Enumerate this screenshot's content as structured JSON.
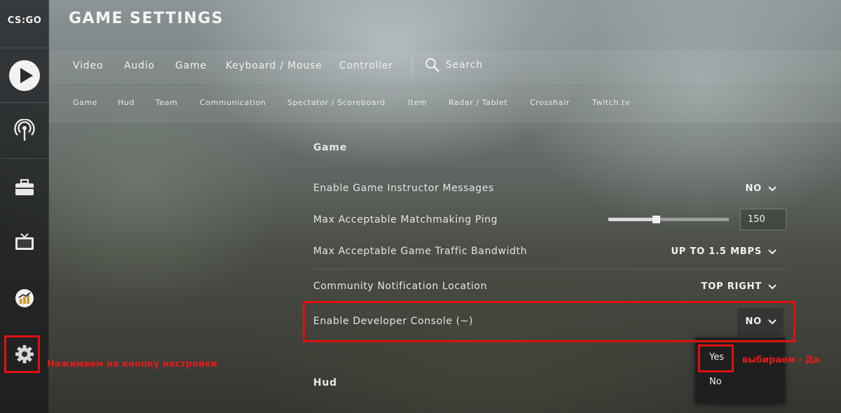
{
  "app": {
    "logo": "CS:GO"
  },
  "header": {
    "title": "GAME SETTINGS"
  },
  "sidebar": {
    "items": [
      {
        "name": "play",
        "icon": "play-icon"
      },
      {
        "name": "broadcast",
        "icon": "antenna-icon"
      },
      {
        "name": "inventory",
        "icon": "briefcase-icon"
      },
      {
        "name": "watch",
        "icon": "tv-icon"
      },
      {
        "name": "stats",
        "icon": "chart-icon"
      },
      {
        "name": "settings",
        "icon": "gear-icon"
      }
    ]
  },
  "top_tabs": [
    "Video",
    "Audio",
    "Game",
    "Keyboard / Mouse",
    "Controller"
  ],
  "search": {
    "label": "Search",
    "icon": "search-icon"
  },
  "sub_tabs": [
    "Game",
    "Hud",
    "Team",
    "Communication",
    "Spectator / Scoreboard",
    "Item",
    "Radar / Tablet",
    "Crosshair",
    "Twitch.tv"
  ],
  "sections": {
    "game": {
      "title": "Game",
      "rows": [
        {
          "label": "Enable Game Instructor Messages",
          "value": "NO"
        },
        {
          "label": "Max Acceptable Matchmaking Ping",
          "value": "150",
          "slider_fraction": 0.4
        },
        {
          "label": "Max Acceptable Game Traffic Bandwidth",
          "value": "UP TO 1.5 MBPS"
        },
        {
          "label": "Community Notification Location",
          "value": "TOP RIGHT"
        },
        {
          "label": "Enable Developer Console (~)",
          "value": "NO"
        }
      ]
    },
    "hud": {
      "title": "Hud"
    }
  },
  "dropdown": {
    "options": [
      "Yes",
      "No"
    ]
  },
  "annotations": {
    "settings_hint": "Нажимаем на кнопку настройки",
    "choose_yes": "выбираем - Да"
  },
  "colors": {
    "highlight": "#e01010",
    "annotation_text": "#e21b1b"
  }
}
